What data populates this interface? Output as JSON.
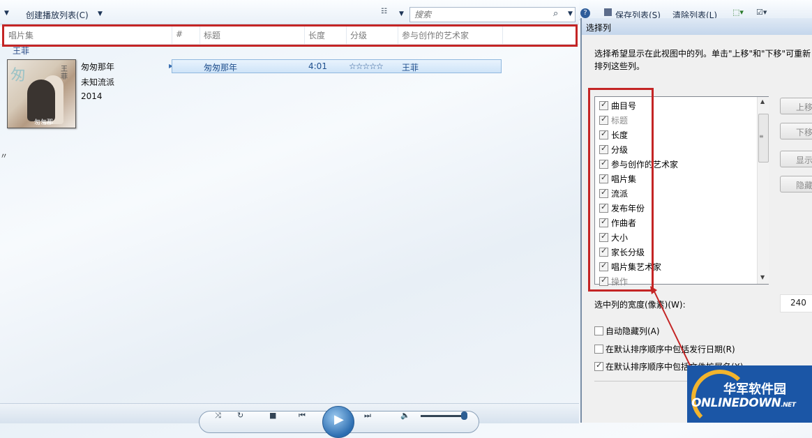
{
  "toolbar": {
    "create_playlist": "创建播放列表(C)",
    "search_placeholder": "搜索",
    "save_list": "保存列表(S)",
    "clear_list": "清除列表(L)"
  },
  "columns": [
    "唱片集",
    "#",
    "标题",
    "长度",
    "分级",
    "参与创作的艺术家"
  ],
  "group_label": "王菲",
  "album": {
    "title": "匆匆那年",
    "genre": "未知流派",
    "year": "2014",
    "art_text": "匆",
    "art_text2": "王菲",
    "art_text3": "匆匆那"
  },
  "track": {
    "title": "匆匆那年",
    "length": "4:01",
    "rating_stars": 0,
    "artist": "王菲"
  },
  "dialog": {
    "title": "选择列",
    "description": "选择希望显示在此视图中的列。单击\"上移\"和\"下移\"可重新排列这些列。",
    "items": [
      {
        "label": "曲目号",
        "checked": true,
        "enabled": true
      },
      {
        "label": "标题",
        "checked": true,
        "enabled": false
      },
      {
        "label": "长度",
        "checked": true,
        "enabled": true
      },
      {
        "label": "分级",
        "checked": true,
        "enabled": true
      },
      {
        "label": "参与创作的艺术家",
        "checked": true,
        "enabled": true
      },
      {
        "label": "唱片集",
        "checked": true,
        "enabled": true
      },
      {
        "label": "流派",
        "checked": true,
        "enabled": true
      },
      {
        "label": "发布年份",
        "checked": true,
        "enabled": true
      },
      {
        "label": "作曲者",
        "checked": true,
        "enabled": true
      },
      {
        "label": "大小",
        "checked": true,
        "enabled": true
      },
      {
        "label": "家长分级",
        "checked": true,
        "enabled": true
      },
      {
        "label": "唱片集艺术家",
        "checked": true,
        "enabled": true
      },
      {
        "label": "操作",
        "checked": true,
        "enabled": false
      }
    ],
    "buttons": {
      "move_up": "上移(U)",
      "move_down": "下移(D)",
      "show": "显示(S)",
      "hide": "隐藏(H)"
    },
    "width_label": "选中列的宽度(像素)(W):",
    "width_value": "240",
    "options": [
      {
        "label": "自动隐藏列(A)",
        "checked": false
      },
      {
        "label": "在默认排序顺序中包括发行日期(R)",
        "checked": false
      },
      {
        "label": "在默认排序顺序中包括文件扩展名(X)",
        "checked": true
      }
    ]
  },
  "watermark": {
    "cn": "华军软件园",
    "en": "ONLINEDOWN",
    "net": ".NET"
  },
  "colors": {
    "highlight": "#c42525",
    "accent": "#2c6db0"
  }
}
